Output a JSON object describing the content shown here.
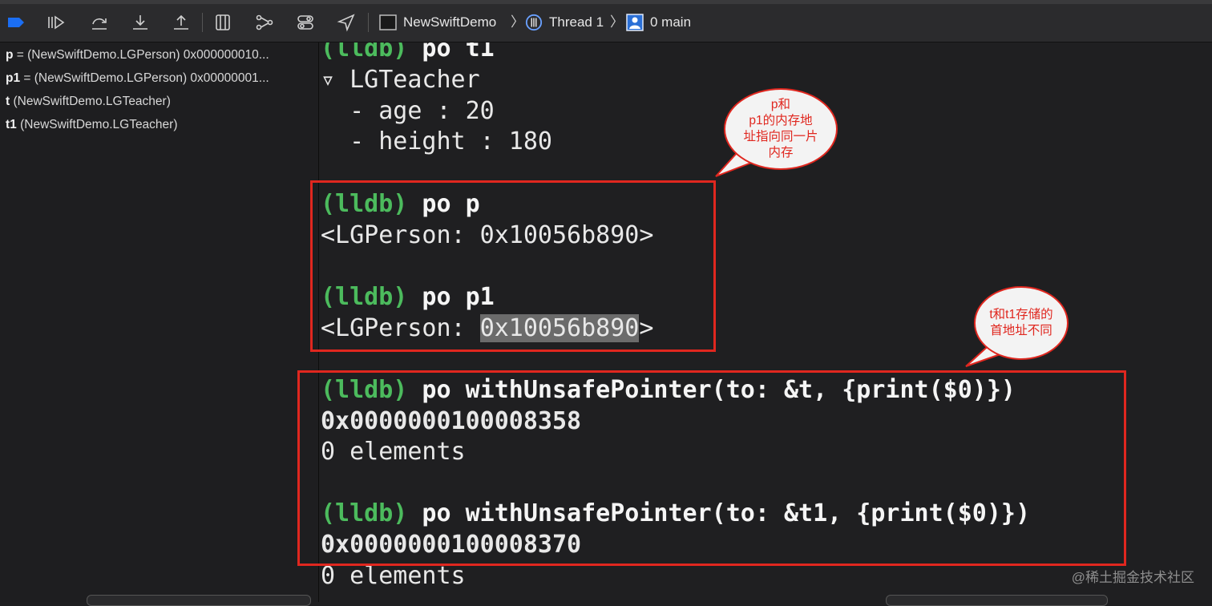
{
  "toolbar": {
    "icons": [
      "breakpoint-toggle-icon",
      "continue-icon",
      "step-over-icon",
      "step-into-icon",
      "step-out-icon",
      "view-hierarchy-icon",
      "memory-graph-icon",
      "environment-overrides-icon",
      "simulate-location-icon"
    ],
    "breadcrumb": {
      "project": "NewSwiftDemo",
      "thread": "Thread 1",
      "frame": "0 main"
    },
    "colors": {
      "accent": "#1b6ef3"
    }
  },
  "variables": [
    {
      "name": "p",
      "rest": " = (NewSwiftDemo.LGPerson) 0x000000010..."
    },
    {
      "name": "p1",
      "rest": " = (NewSwiftDemo.LGPerson) 0x00000001..."
    },
    {
      "name": "t",
      "rest": " (NewSwiftDemo.LGTeacher)"
    },
    {
      "name": "t1",
      "rest": " (NewSwiftDemo.LGTeacher)"
    }
  ],
  "console": {
    "prompt": "(lldb)",
    "lines": {
      "l0_cmd": " po t1",
      "l1": "▿ LGTeacher",
      "l2": "  - age : 20",
      "l3": "  - height : 180",
      "l4_cmd": " po p",
      "l5": "<LGPerson: 0x10056b890>",
      "l6_cmd": " po p1",
      "l7_pre": "<LGPerson: ",
      "l7_hl": "0x10056b890",
      "l7_post": ">",
      "l8_cmd": " po withUnsafePointer(to: &t, {print($0)})",
      "l9": "0x0000000100008358",
      "l10": "0 elements",
      "l11_cmd": " po withUnsafePointer(to: &t1, {print($0)})",
      "l12": "0x0000000100008370",
      "l13": "0 elements"
    },
    "colors": {
      "prompt": "#4cbb5d",
      "annotation": "#e0271f"
    }
  },
  "annotations": {
    "bubble1": [
      "p和",
      "p1的内存地",
      "址指向同一片",
      "内存"
    ],
    "bubble2": [
      "t和t1存储的",
      "首地址不同"
    ]
  },
  "watermark": "@稀土掘金技术社区"
}
